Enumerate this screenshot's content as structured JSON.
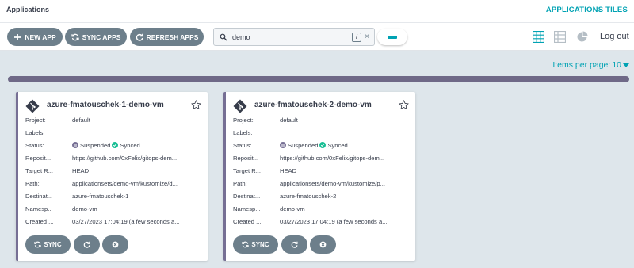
{
  "header": {
    "breadcrumb": "Applications",
    "view_title": "APPLICATIONS TILES"
  },
  "toolbar": {
    "new_app": "NEW APP",
    "sync_apps": "SYNC APPS",
    "refresh_apps": "REFRESH APPS",
    "search_value": "demo",
    "search_shortcut": "/",
    "clear_symbol": "×",
    "logout": "Log out"
  },
  "pagination": {
    "items_per_page_label": "Items per page:",
    "items_per_page_value": "10"
  },
  "progress": {
    "fraction": 1.0
  },
  "labels": {
    "project": "Project:",
    "labels": "Labels:",
    "status": "Status:",
    "repository": "Reposit...",
    "target": "Target R...",
    "path": "Path:",
    "destination": "Destinat...",
    "namespace": "Namesp...",
    "created": "Created ...",
    "sync_btn": "SYNC"
  },
  "apps": [
    {
      "name": "azure-fmatouschek-1-demo-vm",
      "project": "default",
      "labels": "",
      "status_health": "Suspended",
      "status_sync": "Synced",
      "repository": "https://github.com/0xFelix/gitops-dem...",
      "target_revision": "HEAD",
      "path": "applicationsets/demo-vm/kustomize/d...",
      "destination": "azure-fmatouschek-1",
      "namespace": "demo-vm",
      "created": "03/27/2023 17:04:19  (a few seconds a..."
    },
    {
      "name": "azure-fmatouschek-2-demo-vm",
      "project": "default",
      "labels": "",
      "status_health": "Suspended",
      "status_sync": "Synced",
      "repository": "https://github.com/0xFelix/gitops-dem...",
      "target_revision": "HEAD",
      "path": "applicationsets/demo-vm/kustomize/p...",
      "destination": "azure-fmatouschek-2",
      "namespace": "demo-vm",
      "created": "03/27/2023 17:04:19  (a few seconds a..."
    }
  ],
  "colors": {
    "accent": "#00a2b3",
    "button": "#6d7f8b",
    "suspended": "#766f94",
    "synced": "#18be94"
  }
}
